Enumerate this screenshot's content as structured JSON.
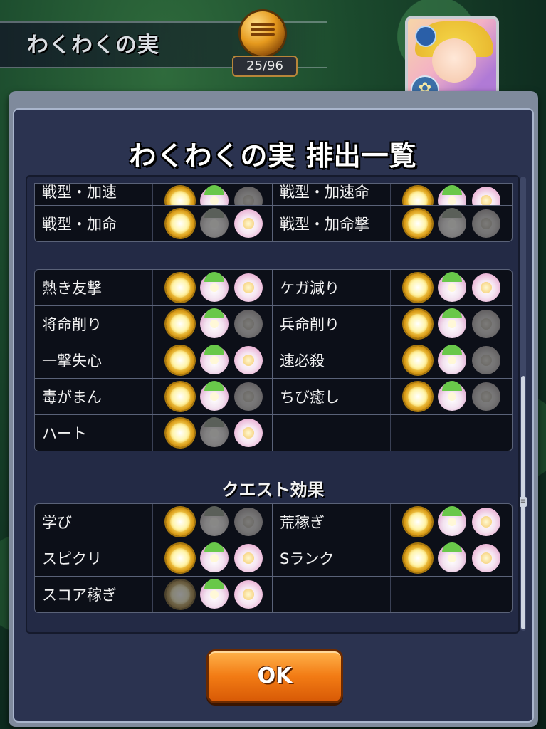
{
  "header": {
    "title": "わくわくの実",
    "counter": "25/96"
  },
  "dialog": {
    "title": "わくわくの実 排出一覧",
    "ok_label": "OK"
  },
  "groups": [
    {
      "rows": [
        {
          "left": {
            "name": "戦型・加速",
            "icons": [
              "sun",
              "lotus",
              "pink-dim"
            ]
          },
          "right": {
            "name": "戦型・加速命",
            "icons": [
              "sun",
              "lotus",
              "pink"
            ]
          }
        },
        {
          "left": {
            "name": "戦型・加命",
            "icons": [
              "sun",
              "lotus-dim",
              "pink"
            ]
          },
          "right": {
            "name": "戦型・加命撃",
            "icons": [
              "sun",
              "lotus-dim",
              "pink-dim"
            ]
          }
        }
      ]
    },
    {
      "rows": [
        {
          "left": {
            "name": "熱き友撃",
            "icons": [
              "sun",
              "lotus",
              "pink"
            ]
          },
          "right": {
            "name": "ケガ減り",
            "icons": [
              "sun",
              "lotus",
              "pink"
            ]
          }
        },
        {
          "left": {
            "name": "将命削り",
            "icons": [
              "sun",
              "lotus",
              "pink-dim"
            ]
          },
          "right": {
            "name": "兵命削り",
            "icons": [
              "sun",
              "lotus",
              "pink-dim"
            ]
          }
        },
        {
          "left": {
            "name": "一撃失心",
            "icons": [
              "sun",
              "lotus",
              "pink"
            ]
          },
          "right": {
            "name": "速必殺",
            "icons": [
              "sun",
              "lotus",
              "pink-dim"
            ]
          }
        },
        {
          "left": {
            "name": "毒がまん",
            "icons": [
              "sun",
              "lotus",
              "pink-dim"
            ]
          },
          "right": {
            "name": "ちび癒し",
            "icons": [
              "sun",
              "lotus",
              "pink-dim"
            ]
          }
        },
        {
          "left": {
            "name": "ハート",
            "icons": [
              "sun",
              "lotus-dim",
              "pink"
            ]
          },
          "right": {
            "name": "",
            "icons": []
          }
        }
      ]
    },
    {
      "section_title": "クエスト効果",
      "rows": [
        {
          "left": {
            "name": "学び",
            "icons": [
              "sun",
              "lotus-dim",
              "pink-dim"
            ]
          },
          "right": {
            "name": "荒稼ぎ",
            "icons": [
              "sun",
              "lotus",
              "pink"
            ]
          }
        },
        {
          "left": {
            "name": "スピクリ",
            "icons": [
              "sun",
              "lotus",
              "pink"
            ]
          },
          "right": {
            "name": "Sランク",
            "icons": [
              "sun",
              "lotus",
              "pink"
            ]
          }
        },
        {
          "left": {
            "name": "スコア稼ぎ",
            "icons": [
              "sun-dim",
              "lotus",
              "pink"
            ]
          },
          "right": {
            "name": "",
            "icons": []
          }
        }
      ]
    }
  ],
  "colors": {
    "panel_bg": "#2b3350",
    "row_bg": "#0c0f18",
    "ok_button": "#f27b14"
  }
}
